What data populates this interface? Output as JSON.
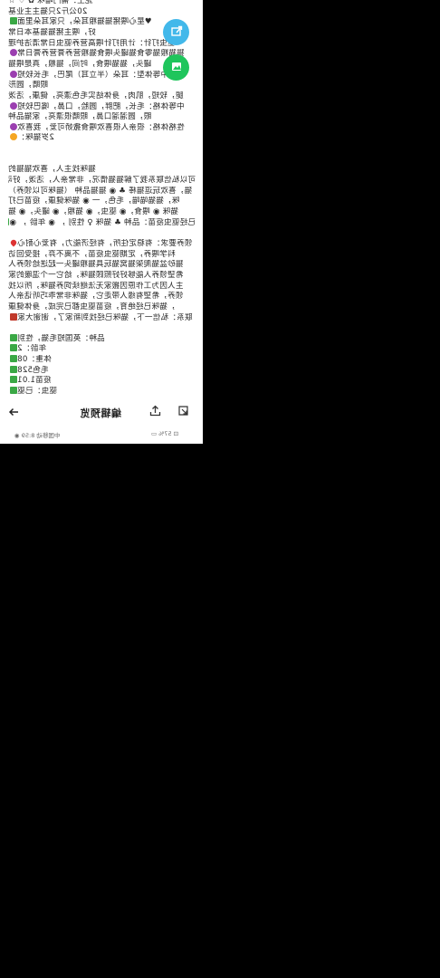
{
  "post": {
    "lines": [
      {
        "marker": "none",
        "text": "泥土：斋门喵咪 ✿ ♡ ☆"
      },
      {
        "marker": "none",
        "text": "20公斤2只猫主主业基"
      },
      {
        "marker": "check",
        "text": "♥星心喂猪猫猫粮耳朵，只家耳朵里面"
      },
      {
        "marker": "none",
        "text": "好，喂主猪猫猫基本日常"
      },
      {
        "marker": "none",
        "text": "驱虫打针：计用打针喂高营养驱虫日常清洁护理"
      },
      {
        "marker": "purple",
        "text": "猫猫粮猫零食猫罐头喂食猫粮营养膏营养膏日常"
      },
      {
        "marker": "none",
        "text": "罐头，猫猫喂食，时间，猫粮，真是喂猫"
      },
      {
        "marker": "purple",
        "text": "中等体型：耳朵（半立耳）尾巴，毛长较短"
      },
      {
        "marker": "none",
        "text": "眼睛，圆形"
      },
      {
        "marker": "none",
        "text": "腿，较短，肌肉，身体结实毛色漂亮，健康，活泼"
      },
      {
        "marker": "purple",
        "text": "中等体格：毛长，肥胖，圆脸，口鼻，嘴巴较短"
      },
      {
        "marker": "none",
        "text": "眼，圆溜溜口鼻，眼睛很漂亮，家猫品种"
      },
      {
        "marker": "purple",
        "text": "性格体格：很亲人很喜欢喂食撒娇可爱，我喜欢"
      },
      {
        "marker": "orange",
        "text": "2岁猫咪："
      },
      {
        "marker": "none",
        "text": " "
      },
      {
        "marker": "none",
        "text": " "
      },
      {
        "marker": "none",
        "text": "猫咪找主人，喜欢猫猫的"
      },
      {
        "marker": "none",
        "text": "可以私信联系我了解猫猫情况，非常亲人，活泼，好动"
      },
      {
        "marker": "none",
        "text": "猫，喜欢玩逗猫棒 ♣ ◉ 猫猫品种 （猫咪可以领养）"
      },
      {
        "marker": "none",
        "text": "咪，猫猫喵喵，毛色，一 ◉ 猫咪健康，疫苗已打"
      },
      {
        "marker": "none",
        "text": "猫咪 ◉ 喂食，◉ 驱虫，◉ 猫粮，◉ 罐头，◉ 猫"
      },
      {
        "marker": "check",
        "text": "已经驱虫疫苗：品种 ♣ 猫咪 ♀ 性别 ， ◉ 年龄 ， ◉"
      },
      {
        "marker": "none",
        "text": " "
      },
      {
        "marker": "heart",
        "text": "领养要求：有稳定住所，有经济能力，有爱心耐心"
      },
      {
        "marker": "none",
        "text": "科学喂养，定期驱虫疫苗，不离不弃，接受回访"
      },
      {
        "marker": "none",
        "text": "猫砂盆猫爬架猫窝猫玩具猫粮罐头一起送给领养人"
      },
      {
        "marker": "none",
        "text": "希望领养人能够好好照顾猫咪，给它一个温暖的家"
      },
      {
        "marker": "none",
        "text": "主人因为工作原因搬家无法继续饲养猫咪，所以找"
      },
      {
        "marker": "none",
        "text": "领养，希望有缘人带走它，猫咪非常乖巧听话亲人"
      },
      {
        "marker": "none",
        "text": "，猫咪已经绝育，疫苗驱虫都已完成，身体健康"
      },
      {
        "marker": "red",
        "text": "联系：私信一下，猫咪已经找到新家了，谢谢大家"
      },
      {
        "marker": "none",
        "text": " "
      },
      {
        "marker": "check",
        "text": "品种：英国短毛猫，性别"
      },
      {
        "marker": "check",
        "text": "年龄：2"
      },
      {
        "marker": "check",
        "text": "体重：08"
      },
      {
        "marker": "check",
        "text": "毛色528"
      },
      {
        "marker": "check",
        "text": "疫苗1.01"
      },
      {
        "marker": "check",
        "text": "驱虫：已驱"
      }
    ]
  },
  "toolbar": {
    "title": "编辑预览",
    "back_icon": "back-arrow-icon",
    "export_icon": "export-icon",
    "open_icon": "open-external-icon"
  },
  "fabs": {
    "share_icon": "share-icon",
    "image_icon": "image-icon",
    "share_color": "#42b8ea",
    "image_color": "#1fc55c"
  },
  "statusbar": {
    "left": "中国移动 8:59 ◉",
    "right": "⊡ 57% ▭"
  }
}
